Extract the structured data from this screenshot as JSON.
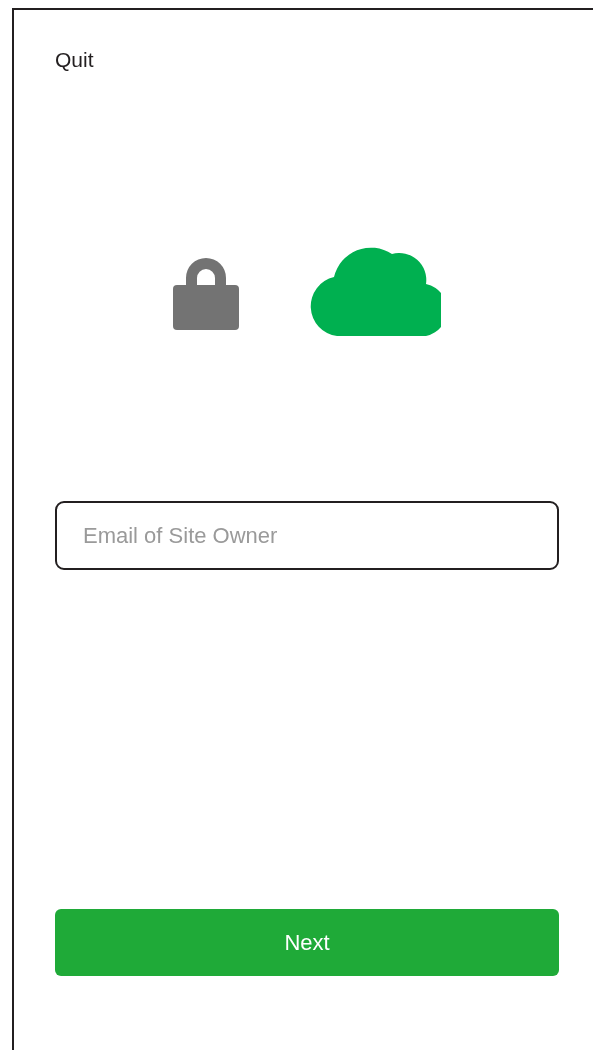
{
  "header": {
    "quit_label": "Quit"
  },
  "email_field": {
    "placeholder": "Email of Site Owner"
  },
  "next_button": {
    "label": "Next"
  }
}
